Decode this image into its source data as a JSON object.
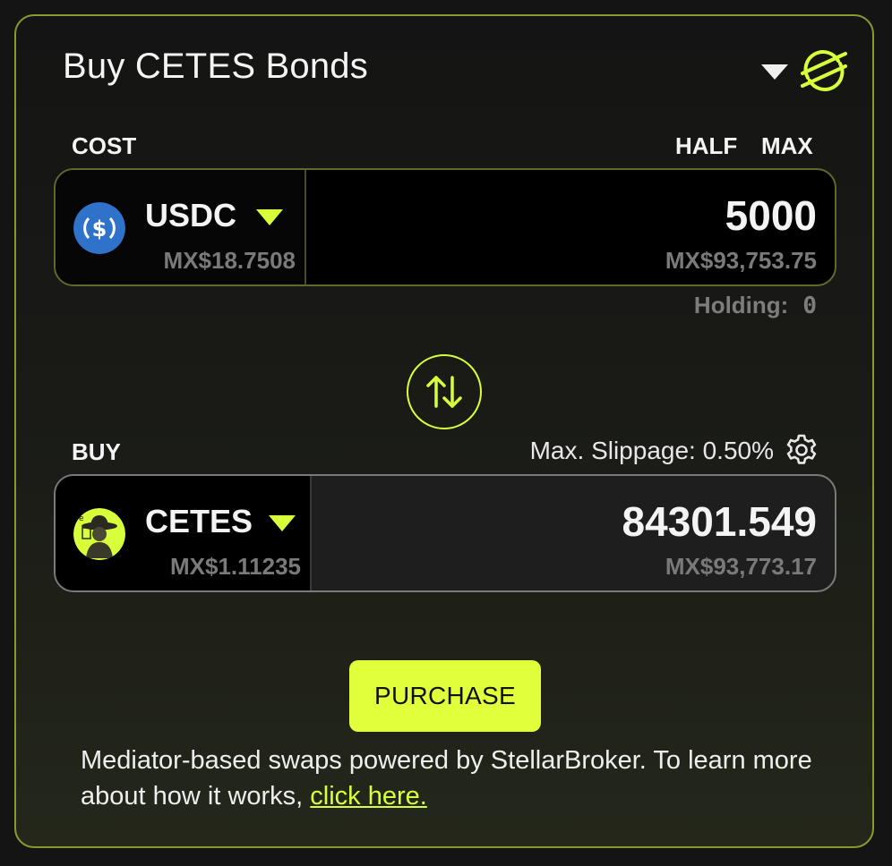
{
  "header": {
    "title": "Buy CETES Bonds",
    "network_dropdown_icon": "caret-down-icon",
    "network_icon": "stellar-icon"
  },
  "cost": {
    "label": "COST",
    "half_label": "HALF",
    "max_label": "MAX",
    "token": {
      "symbol": "USDC",
      "icon": "usdc-icon",
      "price": "MX$18.7508"
    },
    "amount": "5000",
    "amount_fiat": "MX$93,753.75",
    "holding_label": "Holding:",
    "holding_value": "0"
  },
  "swap": {
    "icon": "swap-arrows-icon"
  },
  "buy": {
    "label": "BUY",
    "slippage": "Max. Slippage: 0.50%",
    "settings_icon": "gear-icon",
    "token": {
      "symbol": "CETES",
      "icon": "cetes-icon",
      "price": "MX$1.11235"
    },
    "amount": "84301.549",
    "amount_fiat": "MX$93,773.17"
  },
  "action": {
    "purchase_label": "PURCHASE"
  },
  "footer": {
    "text": "Mediator-based swaps powered by StellarBroker. To learn more about how it works, ",
    "link_text": "click here."
  },
  "colors": {
    "accent": "#d7ff3a",
    "button": "#e2ff3c",
    "border": "#8b9a2e",
    "muted": "#7a7a7a",
    "usdc_blue": "#2f72c9"
  }
}
